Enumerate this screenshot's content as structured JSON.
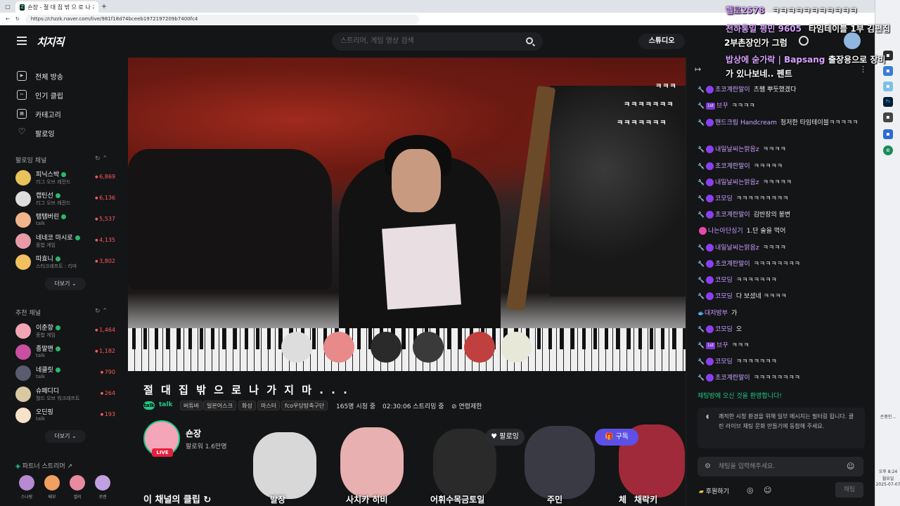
{
  "browser": {
    "tab_title": "숀장 - 절 대 집 밖 으 로 나 가 지 ×",
    "tab_favicon": "Z",
    "new_tab": "+",
    "url": "https://chzzk.naver.com/live/981f18d74bceeb1972197209b7400fc4"
  },
  "header": {
    "logo": "치지직",
    "search_placeholder": "스트리머, 게임 영상 검색",
    "studio_label": "스튜디오"
  },
  "sidebar": {
    "nav": [
      {
        "label": "전체 방송",
        "icon": "live-icon"
      },
      {
        "label": "인기 클립",
        "icon": "clip-icon"
      },
      {
        "label": "카테고리",
        "icon": "category-icon"
      },
      {
        "label": "팔로잉",
        "icon": "heart-icon"
      }
    ],
    "following_title": "팔로잉 채널",
    "following": [
      {
        "name": "피닉스박",
        "sub": "리그 오브 레전드",
        "viewers": "6,869",
        "color": "#e8c25a"
      },
      {
        "name": "캡틴선",
        "sub": "리그 오브 레전드",
        "viewers": "6,136",
        "color": "#dddddd"
      },
      {
        "name": "탬탬버린",
        "sub": "talk",
        "viewers": "5,537",
        "color": "#f0b58a"
      },
      {
        "name": "네네코 마시로",
        "sub": "종합 게임",
        "viewers": "4,135",
        "color": "#e89aa8"
      },
      {
        "name": "따효니",
        "sub": "스타크래프트 : 리마",
        "viewers": "3,802",
        "color": "#f3c060"
      }
    ],
    "more1": "더보기",
    "recommend_title": "추천 채널",
    "recommend": [
      {
        "name": "이춘향",
        "sub": "종합 게임",
        "viewers": "1,464",
        "color": "#f2a5b5"
      },
      {
        "name": "종말맨",
        "sub": "talk",
        "viewers": "1,182",
        "color": "#c94fa0"
      },
      {
        "name": "네클릿",
        "sub": "talk",
        "viewers": "790",
        "color": "#5a5a70"
      },
      {
        "name": "슈페디디",
        "sub": "월드 오브 워크래프트",
        "viewers": "264",
        "color": "#d9c9a0"
      },
      {
        "name": "오딘핑",
        "sub": "talk",
        "viewers": "193",
        "color": "#f6e2c8"
      }
    ],
    "more2": "더보기",
    "partner_title": "파트너 스트리머",
    "partners": [
      {
        "name": "스나랑",
        "color": "#b58ad0"
      },
      {
        "name": "페부",
        "color": "#f0a060"
      },
      {
        "name": "엘리",
        "color": "#e88aa0"
      },
      {
        "name": "로렌",
        "color": "#c0a0e0"
      }
    ]
  },
  "video_overlay": {
    "chat1": "ㅋㅋㅋ",
    "chat2": "ㅋㅋㅋㅋㅋㅋㅋ",
    "chat3": "ㅋㅋㅋㅋㅋㅋㅋ"
  },
  "stream": {
    "title": "절 대 집 밖 으 로 나 가 지 마 . . .",
    "talk_badge": "talk",
    "category": "talk",
    "tags": [
      "버튜버",
      "일본어스크",
      "화성",
      "마스터",
      "fco우당탕축구단"
    ],
    "viewers": "165명 시청 중",
    "uptime": "02:30:06 스트리밍 중",
    "age": "연령제한",
    "channel_name": "숀장",
    "followers": "팔로워 1.6만명",
    "live": "LIVE",
    "follow_label": "팔로잉",
    "subscribe_label": "구독",
    "clips_title": "이 채널의 클립"
  },
  "stickers": {
    "labels": [
      "발장",
      "사치카 히비",
      "어휘수목금토일",
      "주민",
      "체",
      "채락키"
    ]
  },
  "overlay_text": {
    "line1_a": "헬로2578",
    "line1_b": "ㅋㅋㅋㅋㅋㅋㅋㅋㅋㅋㅋ",
    "line2_a": "천하통일 평민 9605",
    "line2_b": "타임테이블 1부 김편집",
    "line3": "2부촌장인가 그럼",
    "line4_a": "밥상에 숟가락 | Bapsang",
    "line4_b": "출장용으로 장비",
    "line5": "가 있나보네.. 펜트"
  },
  "chat": {
    "messages": [
      {
        "user": "초코계란말이",
        "text": "츠쨈 뿌듯했겠다",
        "ucolor": "#c9a8ff",
        "badge": "sub"
      },
      {
        "user": "브꾸",
        "text": "ㅋㅋㅋㅋ",
        "ucolor": "#c99cff",
        "badge": "tier"
      },
      {
        "user": "핸드크림 Handcream",
        "text": "청저한 타임테이블ㅋㅋㅋㅋㅋ",
        "ucolor": "#c9a8ff",
        "badge": "sub"
      },
      {
        "user": "내일날씨는맑음z",
        "text": "ㅋㅋㅋㅋ",
        "ucolor": "#c99cff",
        "badge": "sub"
      },
      {
        "user": "초코계란말이",
        "text": "ㅋㅋㅋㅋㅋ",
        "ucolor": "#c9a8ff",
        "badge": "sub"
      },
      {
        "user": "내일날씨는맑음z",
        "text": "ㅋㅋㅋㅋㅋ",
        "ucolor": "#c99cff",
        "badge": "sub"
      },
      {
        "user": "코모딩",
        "text": "ㅋㅋㅋㅋㅋㅋㅋㅋㅋ",
        "ucolor": "#c99cff",
        "badge": "sub"
      },
      {
        "user": "초코계란말이",
        "text": "김반장의 봉변",
        "ucolor": "#c9a8ff",
        "badge": "sub"
      },
      {
        "user": "나는아단싱기",
        "text": "1.단 술을 먹어",
        "ucolor": "#c99cff",
        "badge": "heart"
      },
      {
        "user": "내일날씨는맑음z",
        "text": "ㅋㅋㅋㅋ",
        "ucolor": "#c99cff",
        "badge": "sub"
      },
      {
        "user": "초코계란말이",
        "text": "ㅋㅋㅋㅋㅋㅋㅋㅋ",
        "ucolor": "#c9a8ff",
        "badge": "sub"
      },
      {
        "user": "코모딩",
        "text": "ㅋㅋㅋㅋㅋㅋㅋ",
        "ucolor": "#c99cff",
        "badge": "sub"
      },
      {
        "user": "코모딩",
        "text": "다 보셨네 ㅋㅋㅋㅋ",
        "ucolor": "#c99cff",
        "badge": "sub"
      },
      {
        "user": "대저방부",
        "text": "가",
        "ucolor": "#c99cff",
        "badge": "fish"
      },
      {
        "user": "코모딩",
        "text": "오",
        "ucolor": "#c99cff",
        "badge": "sub"
      },
      {
        "user": "브꾸",
        "text": "ㅋㅋㅋ",
        "ucolor": "#c99cff",
        "badge": "tier"
      },
      {
        "user": "코모딩",
        "text": "ㅋㅋㅋㅋㅋㅋㅋ",
        "ucolor": "#c99cff",
        "badge": "sub"
      },
      {
        "user": "초코계란말이",
        "text": "ㅋㅋㅋㅋㅋㅋㅋㅋ",
        "ucolor": "#c9a8ff",
        "badge": "sub"
      }
    ],
    "tier_badge": "1st",
    "welcome": "채팅방에 오신 것을 환영합니다!",
    "notice": "쾌적한 시청 환경을 위해 일부 메시지는 필터링 됩니다. 클린 라이브 채팅 문화 만들기에 동참해 주세요.",
    "input_placeholder": "채팅을 입력해주세요.",
    "donate_label": "후원하기",
    "send_label": "채팅"
  },
  "taskbar": {
    "label1": "손중인...",
    "clock_ampm": "오후 8:24",
    "clock_day": "월요일",
    "clock_date": "2025-07-07"
  },
  "colors": {
    "accent": "#1fc987",
    "live": "#e91e3f",
    "subscribe": "#5c50e6"
  }
}
